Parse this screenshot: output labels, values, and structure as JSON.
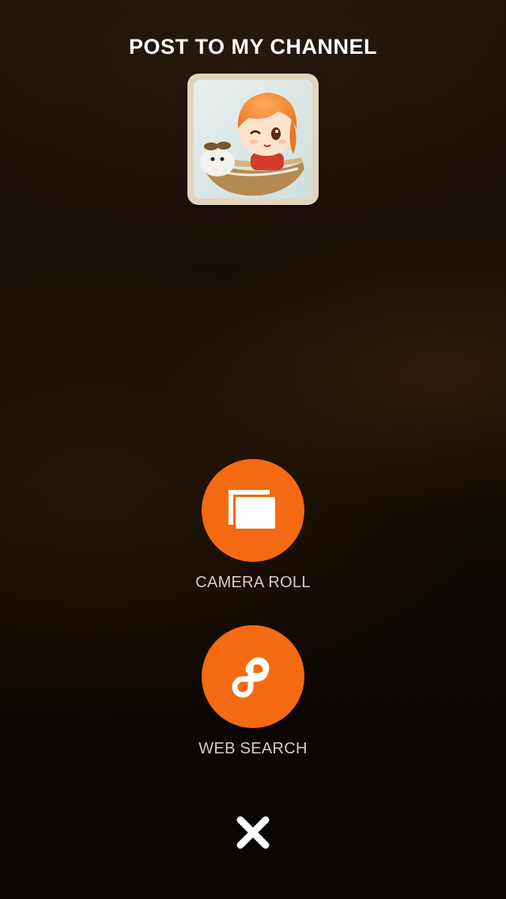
{
  "header": {
    "title": "POST TO MY CHANNEL"
  },
  "preview": {
    "image_icon": "photo-thumbnail"
  },
  "actions": [
    {
      "label": "CAMERA ROLL",
      "icon": "camera-roll-icon"
    },
    {
      "label": "WEB SEARCH",
      "icon": "web-search-icon"
    }
  ],
  "close": {
    "icon": "close-icon"
  },
  "colors": {
    "accent": "#f46a12",
    "label": "#d6ccc2",
    "title": "#ffffff",
    "thumb_border": "#e2d5bb"
  }
}
